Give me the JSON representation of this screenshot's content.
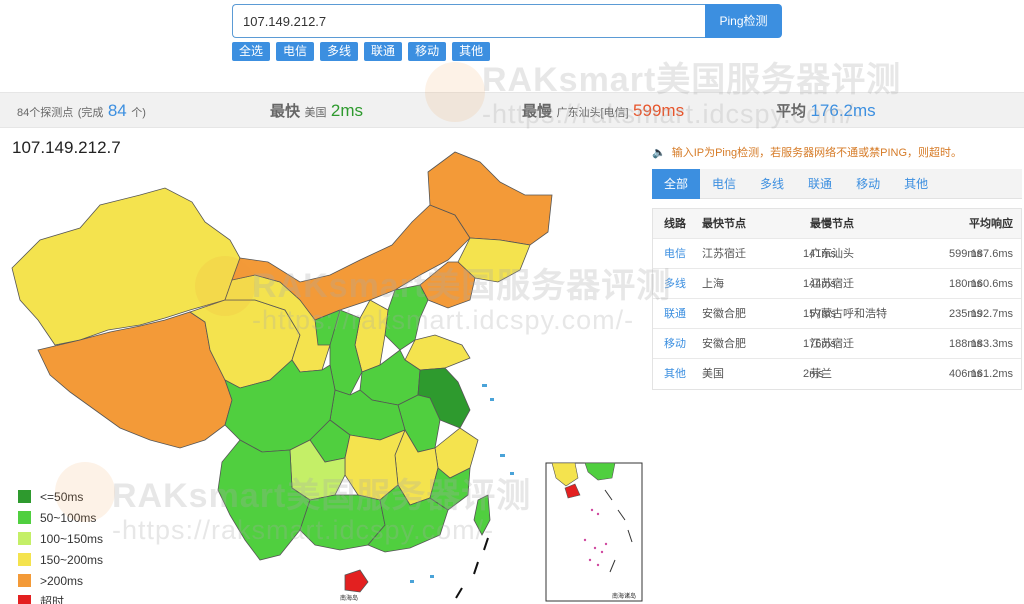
{
  "search": {
    "value": "107.149.212.7",
    "button_label": "Ping检测"
  },
  "filters": [
    "全选",
    "电信",
    "多线",
    "联通",
    "移动",
    "其他"
  ],
  "watermark": {
    "line1": "RAKsmart美国服务器评测",
    "line2": "-https://raksmart.idcspy.com/-"
  },
  "stats": {
    "probes_count_label": "84个探测点",
    "complete_prefix": "(完成",
    "complete_count": "84",
    "complete_suffix": "个)",
    "fastest_label": "最快",
    "fastest_location": "美国",
    "fastest_value": "2ms",
    "slowest_label": "最慢",
    "slowest_location": "广东汕头[电信]",
    "slowest_value": "599ms",
    "average_label": "平均",
    "average_value": "176.2ms"
  },
  "map": {
    "ip_title": "107.149.212.7",
    "legend": [
      {
        "label": "<=50ms",
        "color": "#2e9a2e"
      },
      {
        "label": "50~100ms",
        "color": "#50cf3f"
      },
      {
        "label": "100~150ms",
        "color": "#c4ef67"
      },
      {
        "label": "150~200ms",
        "color": "#f4e34e"
      },
      {
        "label": ">200ms",
        "color": "#f39a38"
      },
      {
        "label": "超时",
        "color": "#e32020"
      }
    ],
    "labels": {
      "hainan": "南海岛",
      "inset_title": "南海诸岛"
    }
  },
  "notice": "输入IP为Ping检测，若服务器网络不通或禁PING，则超时。",
  "tabs": [
    "全部",
    "电信",
    "多线",
    "联通",
    "移动",
    "其他"
  ],
  "active_tab": 0,
  "table": {
    "headers": [
      "线路",
      "最快节点",
      "最慢节点",
      "平均响应"
    ],
    "rows": [
      {
        "line": "电信",
        "fast_node": "江苏宿迁",
        "fast_ms": "141ms",
        "slow_node": "广东汕头",
        "slow_ms": "599ms",
        "avg": "187.6ms"
      },
      {
        "line": "多线",
        "fast_node": "上海",
        "fast_ms": "144ms",
        "slow_node": "江苏宿迁",
        "slow_ms": "180ms",
        "avg": "160.6ms"
      },
      {
        "line": "联通",
        "fast_node": "安徽合肥",
        "fast_ms": "157ms",
        "slow_node": "内蒙古呼和浩特",
        "slow_ms": "235ms",
        "avg": "192.7ms"
      },
      {
        "line": "移动",
        "fast_node": "安徽合肥",
        "fast_ms": "176ms",
        "slow_node": "江苏宿迁",
        "slow_ms": "188ms",
        "avg": "183.3ms"
      },
      {
        "line": "其他",
        "fast_node": "美国",
        "fast_ms": "2ms",
        "slow_node": "芬兰",
        "slow_ms": "406ms",
        "avg": "161.2ms"
      }
    ]
  }
}
